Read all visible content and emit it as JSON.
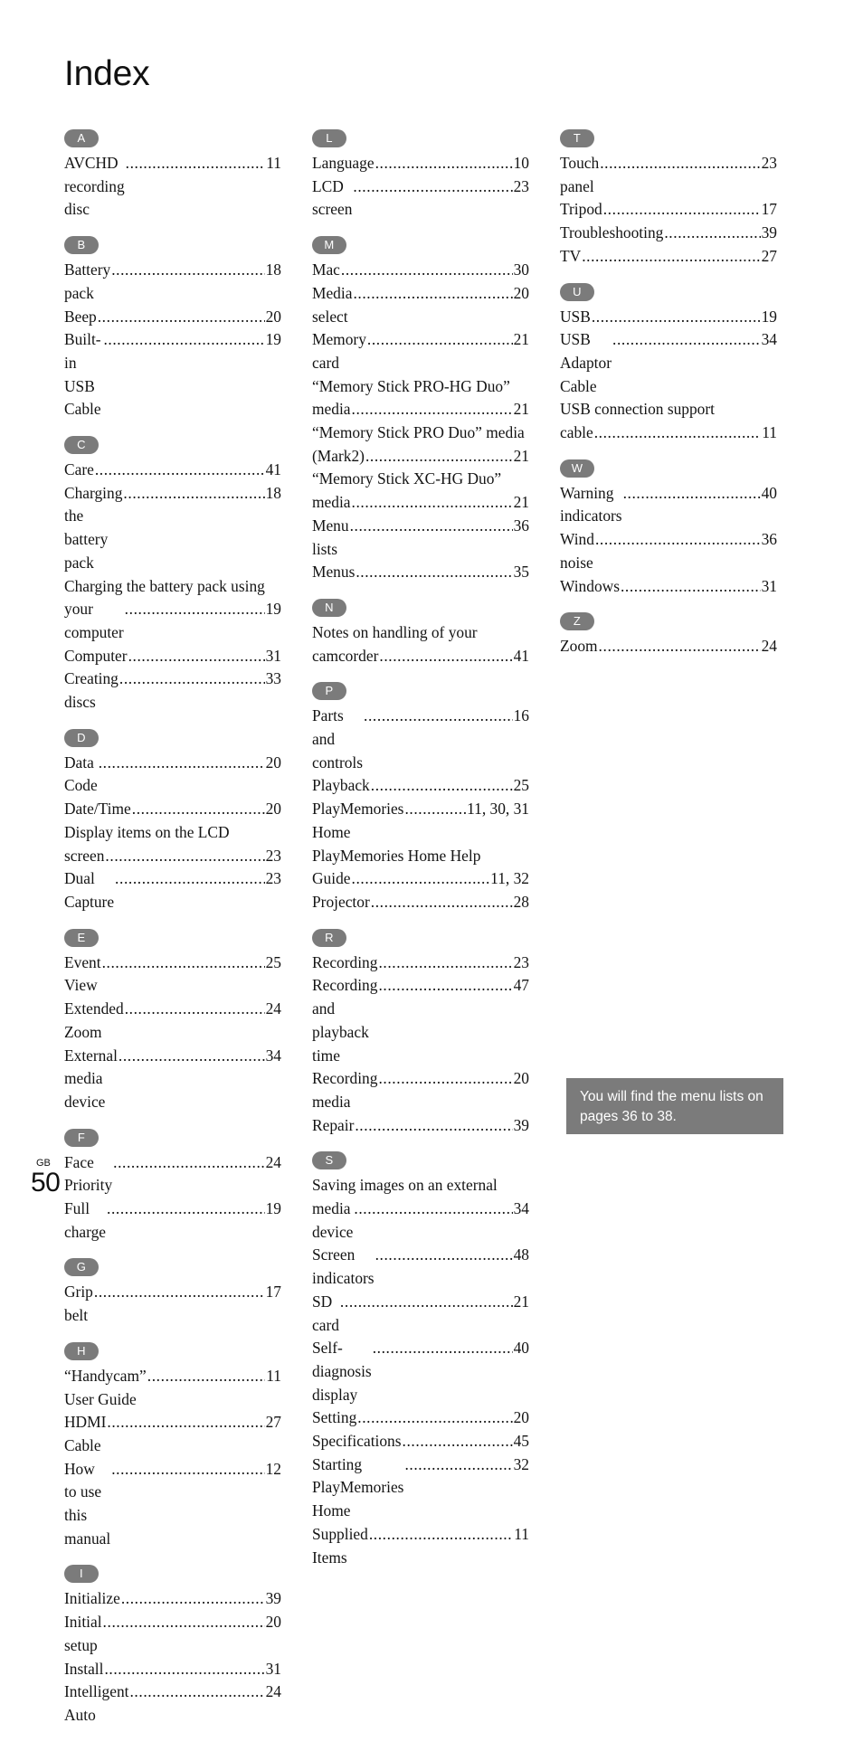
{
  "page": {
    "title": "Index",
    "footer_region": "GB",
    "footer_page_number": "50",
    "badge_color": "#7b7b7b",
    "callout_bg": "#7b7b7b"
  },
  "callout": {
    "text": "You will find the menu lists on pages 36 to 38."
  },
  "columns": [
    {
      "sections": [
        {
          "letter": "A",
          "entries": [
            {
              "text": "AVCHD recording disc",
              "page": "11",
              "wrapped": false
            }
          ]
        },
        {
          "letter": "B",
          "entries": [
            {
              "text": "Battery pack",
              "page": "18",
              "wrapped": false
            },
            {
              "text": "Beep",
              "page": "20",
              "wrapped": false
            },
            {
              "text": "Built-in USB Cable ",
              "page": "19",
              "wrapped": false
            }
          ]
        },
        {
          "letter": "C",
          "entries": [
            {
              "text": "Care ",
              "page": "41",
              "wrapped": false
            },
            {
              "text": "Charging the battery pack",
              "page": "18",
              "wrapped": false
            },
            {
              "text": "Charging the battery pack using",
              "cont": "your computer",
              "page": "19",
              "wrapped": true
            },
            {
              "text": "Computer",
              "page": "31",
              "wrapped": false
            },
            {
              "text": "Creating discs",
              "page": "33",
              "wrapped": false
            }
          ]
        },
        {
          "letter": "D",
          "entries": [
            {
              "text": "Data Code",
              "page": "20",
              "wrapped": false
            },
            {
              "text": "Date/Time",
              "page": "20",
              "wrapped": false
            },
            {
              "text": "Display items on the LCD",
              "cont": "screen ",
              "page": "23",
              "wrapped": true
            },
            {
              "text": "Dual Capture",
              "page": "23",
              "wrapped": false
            }
          ]
        },
        {
          "letter": "E",
          "entries": [
            {
              "text": "Event View",
              "page": "25",
              "wrapped": false
            },
            {
              "text": "Extended Zoom ",
              "page": "24",
              "wrapped": false
            },
            {
              "text": "External media device",
              "page": "34",
              "wrapped": false
            }
          ]
        },
        {
          "letter": "F",
          "entries": [
            {
              "text": "Face Priority ",
              "page": "24",
              "wrapped": false
            },
            {
              "text": "Full charge ",
              "page": "19",
              "wrapped": false
            }
          ]
        },
        {
          "letter": "G",
          "entries": [
            {
              "text": "Grip belt",
              "page": "17",
              "wrapped": false
            }
          ]
        },
        {
          "letter": "H",
          "entries": [
            {
              "text": "“Handycam” User Guide ",
              "page": "11",
              "wrapped": false
            },
            {
              "text": "HDMI Cable",
              "page": "27",
              "wrapped": false
            },
            {
              "text": "How to use this manual ",
              "page": "12",
              "wrapped": false
            }
          ]
        },
        {
          "letter": "I",
          "entries": [
            {
              "text": "Initialize ",
              "page": "39",
              "wrapped": false
            },
            {
              "text": "Initial setup",
              "page": "20",
              "wrapped": false
            },
            {
              "text": "Install",
              "page": "31",
              "wrapped": false
            },
            {
              "text": "Intelligent Auto ",
              "page": "24",
              "wrapped": false
            }
          ]
        }
      ]
    },
    {
      "sections": [
        {
          "letter": "L",
          "entries": [
            {
              "text": "Language",
              "page": "10",
              "wrapped": false
            },
            {
              "text": "LCD screen",
              "page": "23",
              "wrapped": false
            }
          ]
        },
        {
          "letter": "M",
          "entries": [
            {
              "text": "Mac",
              "page": "30",
              "wrapped": false
            },
            {
              "text": "Media select",
              "page": "20",
              "wrapped": false
            },
            {
              "text": "Memory card",
              "page": "21",
              "wrapped": false
            },
            {
              "text": "“Memory Stick PRO-HG Duo”",
              "cont": "media",
              "page": "21",
              "wrapped": true
            },
            {
              "text": "“Memory Stick PRO Duo” media",
              "cont": "(Mark2)",
              "page": "21",
              "wrapped": true
            },
            {
              "text": "“Memory Stick XC-HG Duo”",
              "cont": "media",
              "page": "21",
              "wrapped": true
            },
            {
              "text": "Menu lists ",
              "page": "36",
              "wrapped": false
            },
            {
              "text": "Menus",
              "page": "35",
              "wrapped": false
            }
          ]
        },
        {
          "letter": "N",
          "entries": [
            {
              "text": "Notes on handling of your",
              "cont": "camcorder",
              "page": "41",
              "wrapped": true
            }
          ]
        },
        {
          "letter": "P",
          "entries": [
            {
              "text": "Parts and controls",
              "page": "16",
              "wrapped": false
            },
            {
              "text": "Playback",
              "page": "25",
              "wrapped": false
            },
            {
              "text": "PlayMemories Home",
              "page": "11, 30, 31",
              "wrapped": false
            },
            {
              "text": "PlayMemories Home Help",
              "cont": "Guide",
              "page": "11, 32",
              "wrapped": true
            },
            {
              "text": "Projector ",
              "page": "28",
              "wrapped": false
            }
          ]
        },
        {
          "letter": "R",
          "entries": [
            {
              "text": "Recording ",
              "page": "23",
              "wrapped": false
            },
            {
              "text": "Recording and playback time ",
              "page": "47",
              "wrapped": false
            },
            {
              "text": "Recording media",
              "page": "20",
              "wrapped": false
            },
            {
              "text": "Repair",
              "page": "39",
              "wrapped": false
            }
          ]
        },
        {
          "letter": "S",
          "entries": [
            {
              "text": "Saving images on an external",
              "cont": "media device",
              "page": "34",
              "wrapped": true
            },
            {
              "text": "Screen indicators ",
              "page": "48",
              "wrapped": false
            },
            {
              "text": "SD card",
              "page": "21",
              "wrapped": false
            },
            {
              "text": "Self-diagnosis display",
              "page": "40",
              "wrapped": false
            },
            {
              "text": "Setting ",
              "page": "20",
              "wrapped": false
            },
            {
              "text": "Specifications ",
              "page": "45",
              "wrapped": false
            },
            {
              "text": "Starting PlayMemories Home",
              "page": "32",
              "wrapped": false
            },
            {
              "text": "Supplied Items",
              "page": "11",
              "wrapped": false
            }
          ]
        }
      ]
    },
    {
      "sections": [
        {
          "letter": "T",
          "entries": [
            {
              "text": "Touch panel ",
              "page": "23",
              "wrapped": false
            },
            {
              "text": "Tripod",
              "page": "17",
              "wrapped": false
            },
            {
              "text": "Troubleshooting",
              "page": "39",
              "wrapped": false
            },
            {
              "text": "TV",
              "page": "27",
              "wrapped": false
            }
          ]
        },
        {
          "letter": "U",
          "entries": [
            {
              "text": "USB",
              "page": "19",
              "wrapped": false
            },
            {
              "text": "USB Adaptor Cable ",
              "page": "34",
              "wrapped": false
            },
            {
              "text": "USB connection support",
              "cont": "cable",
              "page": "11",
              "wrapped": true
            }
          ]
        },
        {
          "letter": "W",
          "entries": [
            {
              "text": "Warning indicators",
              "page": "40",
              "wrapped": false
            },
            {
              "text": "Wind noise ",
              "page": "36",
              "wrapped": false
            },
            {
              "text": "Windows",
              "page": "31",
              "wrapped": false
            }
          ]
        },
        {
          "letter": "Z",
          "entries": [
            {
              "text": "Zoom",
              "page": "24",
              "wrapped": false
            }
          ]
        }
      ]
    }
  ]
}
